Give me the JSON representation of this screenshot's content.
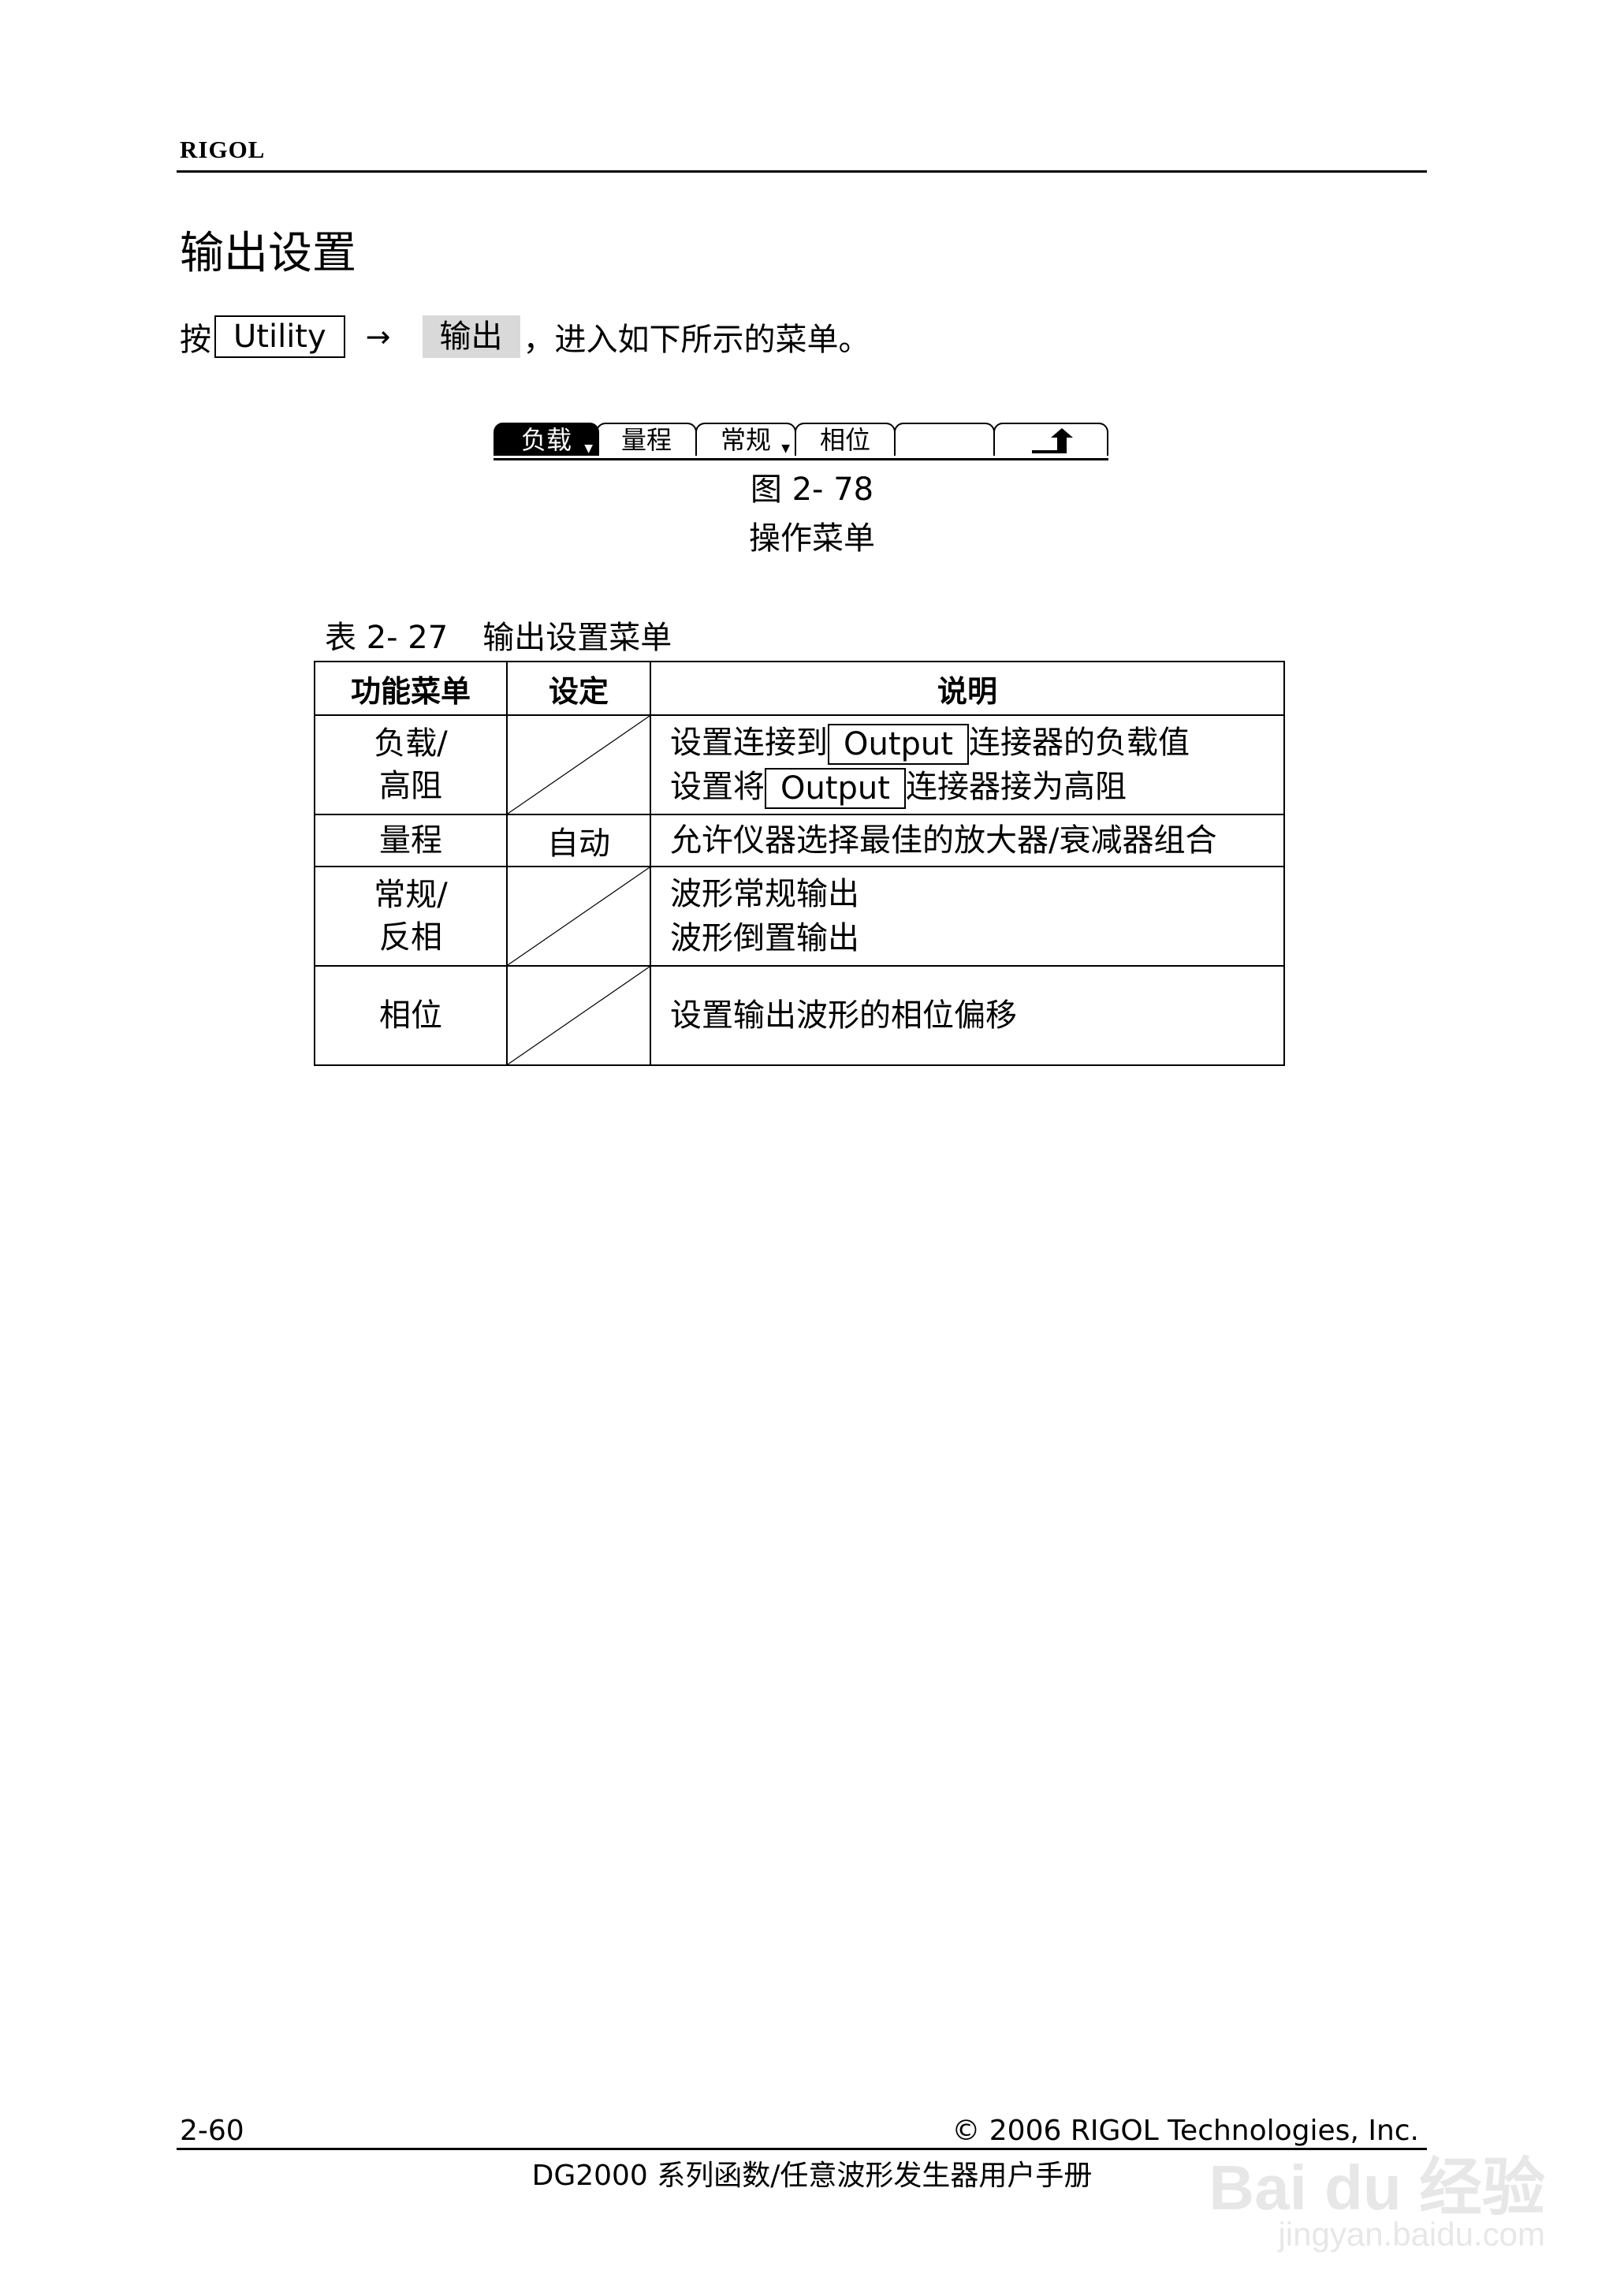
{
  "header": {
    "brand": "RIGOL"
  },
  "section": {
    "title": "输出设置",
    "instruction": {
      "prefix": "按",
      "key": "Utility",
      "arrow": "→",
      "softkey": "输出",
      "suffix": "，进入如下所示的菜单。"
    }
  },
  "menu_bar": {
    "keys": [
      {
        "label": "负载",
        "selected": true,
        "has_submenu": true
      },
      {
        "label": "量程",
        "selected": false,
        "has_submenu": false
      },
      {
        "label": "常规",
        "selected": false,
        "has_submenu": true
      },
      {
        "label": "相位",
        "selected": false,
        "has_submenu": false
      },
      {
        "label": "",
        "selected": false,
        "has_submenu": false
      },
      {
        "icon": "return-arrow-icon",
        "selected": false,
        "has_submenu": false
      }
    ]
  },
  "figure": {
    "number": "图 2- 78",
    "title": "操作菜单"
  },
  "table": {
    "caption_num": "表 2- 27",
    "caption_title": "输出设置菜单",
    "headers": [
      "功能菜单",
      "设定",
      "说明"
    ],
    "rows": [
      {
        "menu": [
          "负载/",
          "高阻"
        ],
        "setting": "",
        "desc": [
          {
            "pre": "设置连接到",
            "box": "Output",
            "post": "连接器的负载值"
          },
          {
            "pre": "设置将",
            "box": "Output",
            "post": "连接器接为高阻"
          }
        ]
      },
      {
        "menu": [
          "量程"
        ],
        "setting": "自动",
        "desc": [
          {
            "pre": "允许仪器选择最佳的放大器/衰减器组合",
            "box": "",
            "post": ""
          }
        ]
      },
      {
        "menu": [
          "常规/",
          "反相"
        ],
        "setting": "",
        "desc": [
          {
            "pre": "波形常规输出",
            "box": "",
            "post": ""
          },
          {
            "pre": "波形倒置输出",
            "box": "",
            "post": ""
          }
        ]
      },
      {
        "menu": [
          "相位"
        ],
        "setting": "",
        "desc": [
          {
            "pre": "设置输出波形的相位偏移",
            "box": "",
            "post": ""
          }
        ]
      }
    ]
  },
  "footer": {
    "page": "2-60",
    "copyright": "© 2006 RIGOL Technologies, Inc.",
    "product": "DG2000 系列函数/任意波形发生器用户手册"
  },
  "watermark": {
    "logo": "Bai du 经验",
    "url": "jingyan.baidu.com"
  }
}
